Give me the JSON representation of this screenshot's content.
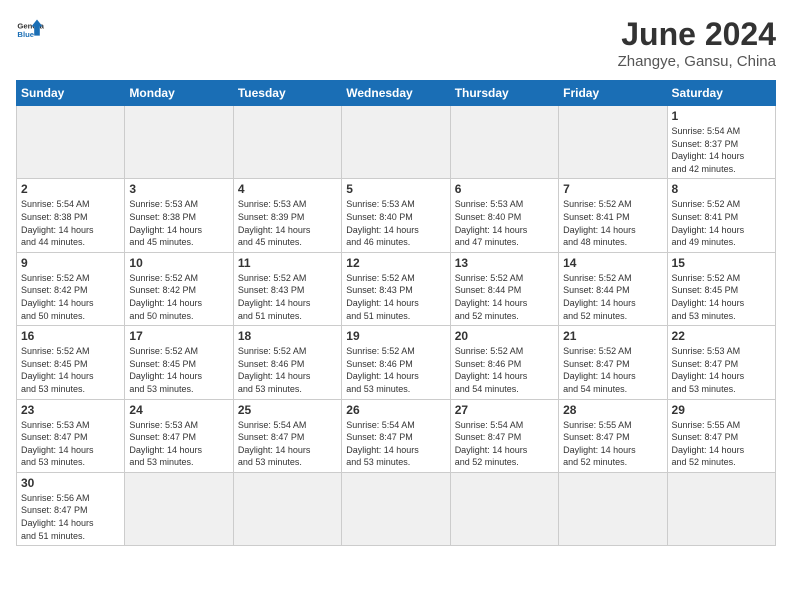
{
  "header": {
    "logo_general": "General",
    "logo_blue": "Blue",
    "month_year": "June 2024",
    "location": "Zhangye, Gansu, China"
  },
  "weekdays": [
    "Sunday",
    "Monday",
    "Tuesday",
    "Wednesday",
    "Thursday",
    "Friday",
    "Saturday"
  ],
  "days": [
    {
      "num": "",
      "empty": true,
      "info": ""
    },
    {
      "num": "",
      "empty": true,
      "info": ""
    },
    {
      "num": "",
      "empty": true,
      "info": ""
    },
    {
      "num": "",
      "empty": true,
      "info": ""
    },
    {
      "num": "",
      "empty": true,
      "info": ""
    },
    {
      "num": "",
      "empty": true,
      "info": ""
    },
    {
      "num": "1",
      "empty": false,
      "info": "Sunrise: 5:54 AM\nSunset: 8:37 PM\nDaylight: 14 hours\nand 42 minutes."
    },
    {
      "num": "2",
      "empty": false,
      "info": "Sunrise: 5:54 AM\nSunset: 8:38 PM\nDaylight: 14 hours\nand 44 minutes."
    },
    {
      "num": "3",
      "empty": false,
      "info": "Sunrise: 5:53 AM\nSunset: 8:38 PM\nDaylight: 14 hours\nand 45 minutes."
    },
    {
      "num": "4",
      "empty": false,
      "info": "Sunrise: 5:53 AM\nSunset: 8:39 PM\nDaylight: 14 hours\nand 45 minutes."
    },
    {
      "num": "5",
      "empty": false,
      "info": "Sunrise: 5:53 AM\nSunset: 8:40 PM\nDaylight: 14 hours\nand 46 minutes."
    },
    {
      "num": "6",
      "empty": false,
      "info": "Sunrise: 5:53 AM\nSunset: 8:40 PM\nDaylight: 14 hours\nand 47 minutes."
    },
    {
      "num": "7",
      "empty": false,
      "info": "Sunrise: 5:52 AM\nSunset: 8:41 PM\nDaylight: 14 hours\nand 48 minutes."
    },
    {
      "num": "8",
      "empty": false,
      "info": "Sunrise: 5:52 AM\nSunset: 8:41 PM\nDaylight: 14 hours\nand 49 minutes."
    },
    {
      "num": "9",
      "empty": false,
      "info": "Sunrise: 5:52 AM\nSunset: 8:42 PM\nDaylight: 14 hours\nand 50 minutes."
    },
    {
      "num": "10",
      "empty": false,
      "info": "Sunrise: 5:52 AM\nSunset: 8:42 PM\nDaylight: 14 hours\nand 50 minutes."
    },
    {
      "num": "11",
      "empty": false,
      "info": "Sunrise: 5:52 AM\nSunset: 8:43 PM\nDaylight: 14 hours\nand 51 minutes."
    },
    {
      "num": "12",
      "empty": false,
      "info": "Sunrise: 5:52 AM\nSunset: 8:43 PM\nDaylight: 14 hours\nand 51 minutes."
    },
    {
      "num": "13",
      "empty": false,
      "info": "Sunrise: 5:52 AM\nSunset: 8:44 PM\nDaylight: 14 hours\nand 52 minutes."
    },
    {
      "num": "14",
      "empty": false,
      "info": "Sunrise: 5:52 AM\nSunset: 8:44 PM\nDaylight: 14 hours\nand 52 minutes."
    },
    {
      "num": "15",
      "empty": false,
      "info": "Sunrise: 5:52 AM\nSunset: 8:45 PM\nDaylight: 14 hours\nand 53 minutes."
    },
    {
      "num": "16",
      "empty": false,
      "info": "Sunrise: 5:52 AM\nSunset: 8:45 PM\nDaylight: 14 hours\nand 53 minutes."
    },
    {
      "num": "17",
      "empty": false,
      "info": "Sunrise: 5:52 AM\nSunset: 8:45 PM\nDaylight: 14 hours\nand 53 minutes."
    },
    {
      "num": "18",
      "empty": false,
      "info": "Sunrise: 5:52 AM\nSunset: 8:46 PM\nDaylight: 14 hours\nand 53 minutes."
    },
    {
      "num": "19",
      "empty": false,
      "info": "Sunrise: 5:52 AM\nSunset: 8:46 PM\nDaylight: 14 hours\nand 53 minutes."
    },
    {
      "num": "20",
      "empty": false,
      "info": "Sunrise: 5:52 AM\nSunset: 8:46 PM\nDaylight: 14 hours\nand 54 minutes."
    },
    {
      "num": "21",
      "empty": false,
      "info": "Sunrise: 5:52 AM\nSunset: 8:47 PM\nDaylight: 14 hours\nand 54 minutes."
    },
    {
      "num": "22",
      "empty": false,
      "info": "Sunrise: 5:53 AM\nSunset: 8:47 PM\nDaylight: 14 hours\nand 53 minutes."
    },
    {
      "num": "23",
      "empty": false,
      "info": "Sunrise: 5:53 AM\nSunset: 8:47 PM\nDaylight: 14 hours\nand 53 minutes."
    },
    {
      "num": "24",
      "empty": false,
      "info": "Sunrise: 5:53 AM\nSunset: 8:47 PM\nDaylight: 14 hours\nand 53 minutes."
    },
    {
      "num": "25",
      "empty": false,
      "info": "Sunrise: 5:54 AM\nSunset: 8:47 PM\nDaylight: 14 hours\nand 53 minutes."
    },
    {
      "num": "26",
      "empty": false,
      "info": "Sunrise: 5:54 AM\nSunset: 8:47 PM\nDaylight: 14 hours\nand 53 minutes."
    },
    {
      "num": "27",
      "empty": false,
      "info": "Sunrise: 5:54 AM\nSunset: 8:47 PM\nDaylight: 14 hours\nand 52 minutes."
    },
    {
      "num": "28",
      "empty": false,
      "info": "Sunrise: 5:55 AM\nSunset: 8:47 PM\nDaylight: 14 hours\nand 52 minutes."
    },
    {
      "num": "29",
      "empty": false,
      "info": "Sunrise: 5:55 AM\nSunset: 8:47 PM\nDaylight: 14 hours\nand 52 minutes."
    },
    {
      "num": "30",
      "empty": false,
      "info": "Sunrise: 5:56 AM\nSunset: 8:47 PM\nDaylight: 14 hours\nand 51 minutes."
    },
    {
      "num": "",
      "empty": true,
      "info": ""
    },
    {
      "num": "",
      "empty": true,
      "info": ""
    },
    {
      "num": "",
      "empty": true,
      "info": ""
    },
    {
      "num": "",
      "empty": true,
      "info": ""
    },
    {
      "num": "",
      "empty": true,
      "info": ""
    },
    {
      "num": "",
      "empty": true,
      "info": ""
    }
  ]
}
